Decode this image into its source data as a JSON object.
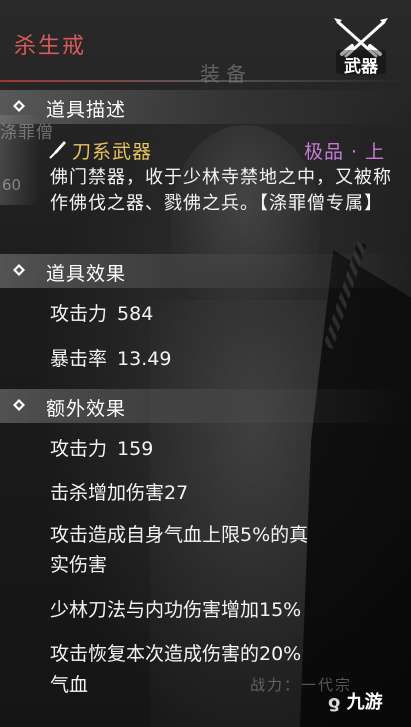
{
  "title": "杀生戒",
  "panel_tab": "装备",
  "badge": {
    "label": "武器",
    "icon": "crossed-swords-icon"
  },
  "left_art": {
    "name": "涤罪僧",
    "number": "60"
  },
  "sections": {
    "description": {
      "header": "道具描述",
      "weapon_type": "刀系武器",
      "quality": "极品 · 上",
      "text": "佛门禁器，收于少林寺禁地之中，又被称作佛伐之器、戮佛之兵。【涤罪僧专属】"
    },
    "effects": {
      "header": "道具效果",
      "stats": [
        {
          "label": "攻击力",
          "value": "584"
        },
        {
          "label": "暴击率",
          "value": "13.49"
        }
      ]
    },
    "extra": {
      "header": "额外效果",
      "attack_label": "攻击力",
      "attack_value": "159",
      "line1": "击杀增加伤害27",
      "line2": "攻击造成自身气血上限5%的真",
      "line2b": "实伤害",
      "line3": "少林刀法与内功伤害增加15%",
      "line4": "攻击恢复本次造成伤害的20%",
      "line4b": "气血"
    }
  },
  "power_text": "战力：一代宗",
  "logo": "九游",
  "colors": {
    "title_red": "#d85a5a",
    "weapon_gold": "#e6c35c",
    "quality_purple": "#c77ad6"
  }
}
